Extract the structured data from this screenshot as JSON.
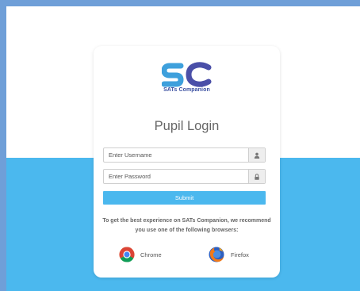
{
  "brand": {
    "logo_text": "SATs Companion",
    "logo_colors": {
      "s": "#3ea0dc",
      "c": "#4a4fa8"
    }
  },
  "login": {
    "title": "Pupil Login",
    "username_placeholder": "Enter Username",
    "password_placeholder": "Enter Password",
    "submit_label": "Submit",
    "username_icon": "user-icon",
    "password_icon": "lock-icon"
  },
  "recommendation": {
    "text": "To get the best experience on SATs Companion, we recommend you use one of the following browsers:",
    "browsers": [
      {
        "label": "Chrome",
        "icon": "chrome-icon"
      },
      {
        "label": "Firefox",
        "icon": "firefox-icon"
      }
    ]
  },
  "colors": {
    "accent": "#4bb8ee",
    "page_border": "#6f9fd8",
    "title_text": "#666666"
  }
}
